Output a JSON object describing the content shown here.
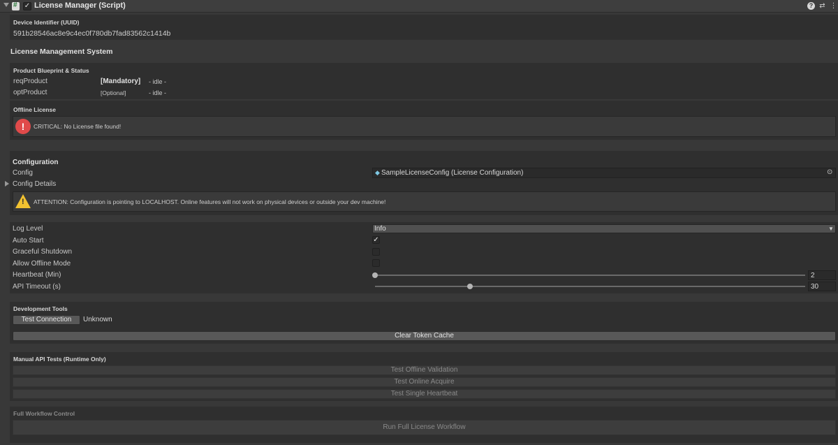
{
  "header": {
    "title": "License Manager (Script)",
    "enabled": true
  },
  "device": {
    "label": "Device Identifier (UUID)",
    "value": "591b28546ac8e9c4ec0f780db7fad83562c1414b"
  },
  "system_title": "License Management System",
  "products": {
    "label": "Product Blueprint & Status",
    "rows": [
      {
        "name": "reqProduct",
        "tag": "[Mandatory]",
        "status": "- idle -"
      },
      {
        "name": "optProduct",
        "tag": "[Optional]",
        "status": "- idle -"
      }
    ]
  },
  "offline": {
    "label": "Offline License",
    "message": "CRITICAL: No License file found!"
  },
  "configuration": {
    "heading": "Configuration",
    "config_label": "Config",
    "config_value": "SampleLicenseConfig (License Configuration)",
    "details_label": "Config Details",
    "warning": "ATTENTION: Configuration is pointing to LOCALHOST. Online features will not work on physical devices or outside your dev machine!"
  },
  "settings": {
    "log_level_label": "Log Level",
    "log_level_value": "Info",
    "auto_start_label": "Auto Start",
    "auto_start": true,
    "graceful_label": "Graceful Shutdown",
    "graceful": false,
    "offline_mode_label": "Allow Offline Mode",
    "offline_mode": false,
    "heartbeat_label": "Heartbeat (Min)",
    "heartbeat_value": "2",
    "heartbeat_fraction": 0.0,
    "timeout_label": "API Timeout (s)",
    "timeout_value": "30",
    "timeout_fraction": 0.22
  },
  "dev_tools": {
    "label": "Development Tools",
    "test_connection": "Test Connection",
    "connection_status": "Unknown",
    "clear_cache": "Clear Token Cache"
  },
  "manual_tests": {
    "label": "Manual API Tests (Runtime Only)",
    "buttons": [
      "Test Offline Validation",
      "Test Online Acquire",
      "Test Single Heartbeat"
    ]
  },
  "workflow": {
    "label": "Full Workflow Control",
    "button": "Run Full License Workflow"
  },
  "colors": {
    "error": "#e04a4a",
    "warning": "#f2c230"
  }
}
